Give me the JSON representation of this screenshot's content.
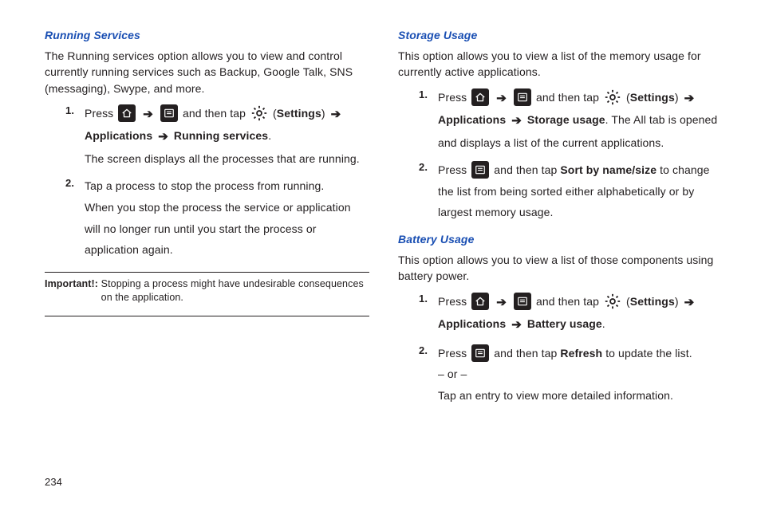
{
  "page_number": "234",
  "left": {
    "heading1": "Running Services",
    "intro1": "The Running services option allows you to view and control currently running services such as Backup, Google Talk, SNS (messaging), Swype, and more.",
    "s1_press": "Press",
    "s1_andthen": "and then tap",
    "s1_settings": "Settings",
    "s1_path1": "Applications",
    "s1_path2": "Running services",
    "s1_after": "The screen displays all the processes that are running.",
    "s2": "Tap a process to stop the process from running.",
    "s2_after": "When you stop the process the service or application will no longer run until you start the process or application again.",
    "important_label": "Important!:",
    "important_text": "Stopping a process might have undesirable consequences on the application."
  },
  "right": {
    "heading1": "Storage Usage",
    "intro1": "This option allows you to view a list of the memory usage for currently active applications.",
    "r1_press": "Press",
    "r1_andthen": "and then tap",
    "r1_settings": "Settings",
    "r1_path1": "Applications",
    "r1_path2": "Storage usage",
    "r1_after": ". The All tab is opened and displays a list of the current applications.",
    "r2_press": "Press",
    "r2_andthen": "and then tap",
    "r2_sort": "Sort by name/size",
    "r2_after": " to change the list from being sorted either alphabetically or by largest memory usage.",
    "heading2": "Battery Usage",
    "intro2": "This option allows you to view a list of those components using battery power.",
    "b1_press": "Press",
    "b1_andthen": "and then tap",
    "b1_settings": "Settings",
    "b1_path1": "Applications",
    "b1_path2": "Battery usage",
    "b2_press": "Press",
    "b2_andthen": "and then tap",
    "b2_refresh": "Refresh",
    "b2_after": " to update the list.",
    "b2_or": "– or –",
    "b2_tap": "Tap an entry to view more detailed information."
  }
}
